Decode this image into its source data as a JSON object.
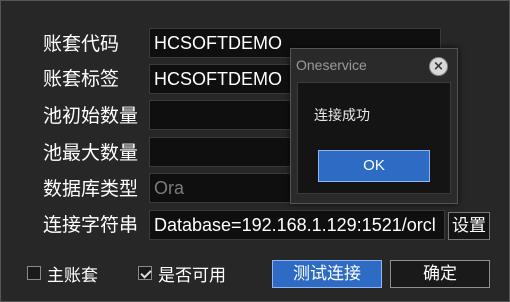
{
  "form": {
    "account_code_label": "账套代码",
    "account_code_value": "HCSOFTDEMO",
    "account_tag_label": "账套标签",
    "account_tag_value": "HCSOFTDEMO",
    "pool_init_label": "池初始数量",
    "pool_init_value": "",
    "pool_max_label": "池最大数量",
    "pool_max_value": "",
    "db_type_label": "数据库类型",
    "db_type_value": "Ora",
    "conn_string_label": "连接字符串",
    "conn_string_value": "Database=192.168.1.129:1521/orcl",
    "settings_button": "设置"
  },
  "footer": {
    "main_account_label": "主账套",
    "main_account_checked": false,
    "available_label": "是否可用",
    "available_checked": true,
    "test_connection_button": "测试连接",
    "confirm_button": "确定"
  },
  "dialog": {
    "title": "Oneservice",
    "message": "连接成功",
    "ok_button": "OK"
  },
  "colors": {
    "primary": "#2d6bc4",
    "background": "#272727",
    "field_bg": "#0f0f0f"
  }
}
